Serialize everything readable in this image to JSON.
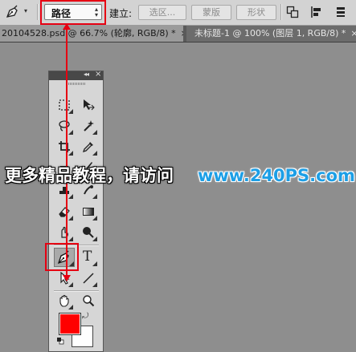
{
  "options_bar": {
    "mode_value": "路径",
    "build_label": "建立:",
    "selection_button": "选区...",
    "mask_button": "蒙版",
    "shape_button": "形状"
  },
  "tabs": [
    {
      "label": "20104528.psd @ 66.7% (轮廓, RGB/8) *",
      "close": "×"
    },
    {
      "label": "未标题-1 @ 100% (图层 1, RGB/8) *",
      "close": "×"
    }
  ],
  "tools_panel": {
    "collapse_glyph": "◂◂",
    "close_glyph": "×",
    "text_tool_glyph": "T",
    "foreground_color": "#ff0000",
    "background_color": "#ffffff"
  },
  "highlight_color": "#e60012",
  "watermark": {
    "text": "更多精品教程，请访问",
    "url": "www.240PS.com"
  }
}
